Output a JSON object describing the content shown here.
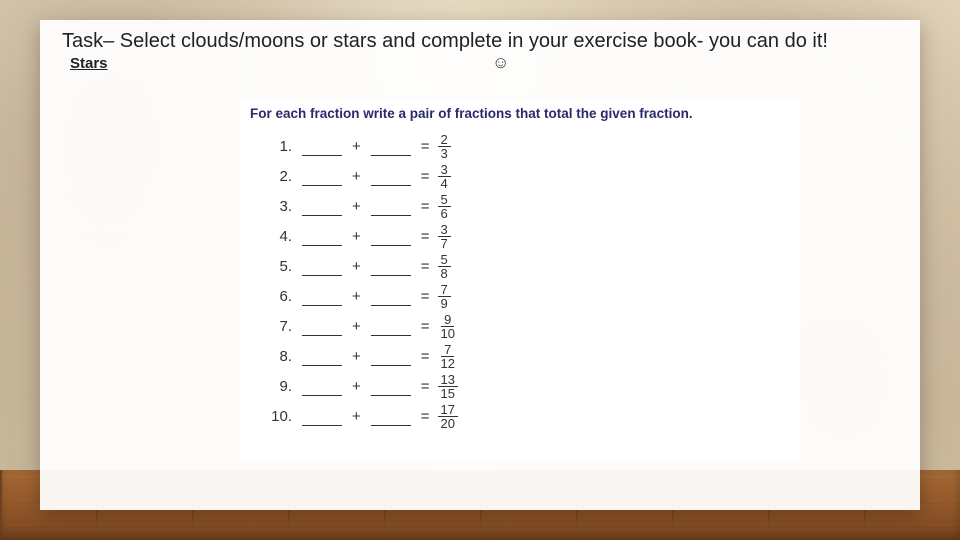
{
  "header": {
    "title": "Task– Select clouds/moons or stars and complete in your exercise book- you can do it!",
    "level": "Stars",
    "smile": "☺"
  },
  "worksheet": {
    "heading": "For each fraction write a pair of fractions that total the given fraction.",
    "plus": "+",
    "equals": "=",
    "items": [
      {
        "n": "1.",
        "numer": "2",
        "denom": "3"
      },
      {
        "n": "2.",
        "numer": "3",
        "denom": "4"
      },
      {
        "n": "3.",
        "numer": "5",
        "denom": "6"
      },
      {
        "n": "4.",
        "numer": "3",
        "denom": "7"
      },
      {
        "n": "5.",
        "numer": "5",
        "denom": "8"
      },
      {
        "n": "6.",
        "numer": "7",
        "denom": "9"
      },
      {
        "n": "7.",
        "numer": "9",
        "denom": "10"
      },
      {
        "n": "8.",
        "numer": "7",
        "denom": "12"
      },
      {
        "n": "9.",
        "numer": "13",
        "denom": "15"
      },
      {
        "n": "10.",
        "numer": "17",
        "denom": "20"
      }
    ]
  }
}
